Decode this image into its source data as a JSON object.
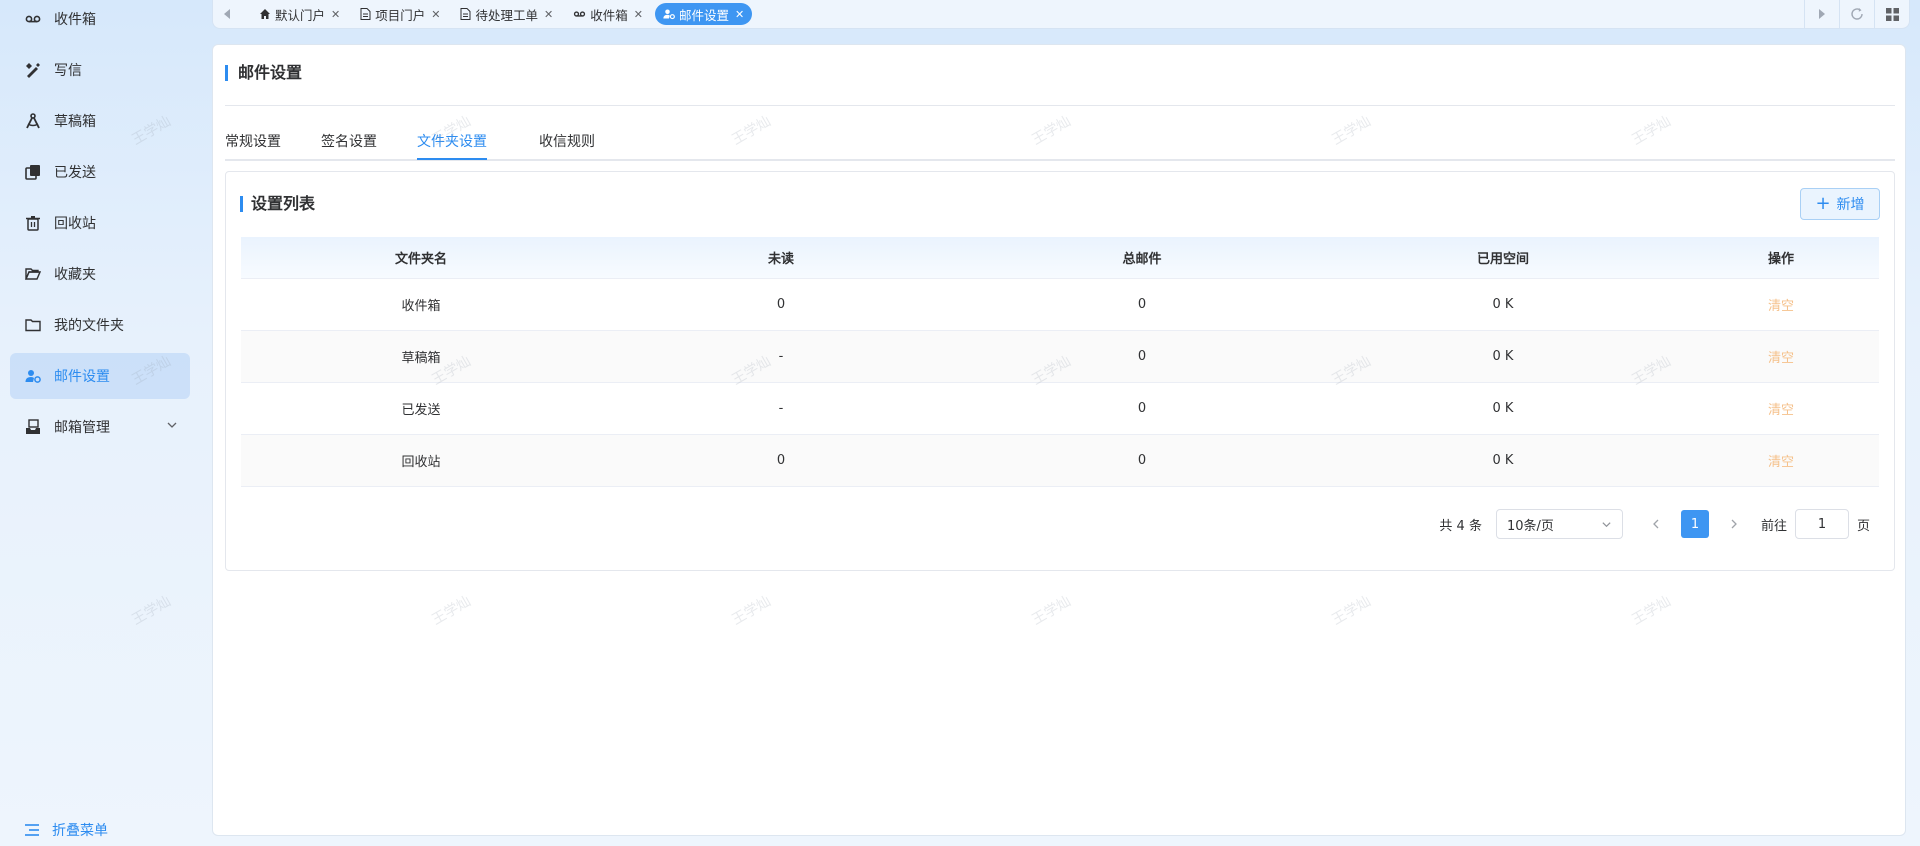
{
  "sidebar": {
    "items": [
      {
        "label": "收件箱",
        "icon": "voicemail-icon"
      },
      {
        "label": "写信",
        "icon": "pen-ruler-icon"
      },
      {
        "label": "草稿箱",
        "icon": "drafting-compass-icon"
      },
      {
        "label": "已发送",
        "icon": "copy-stack-icon"
      },
      {
        "label": "回收站",
        "icon": "trash-icon"
      },
      {
        "label": "收藏夹",
        "icon": "folder-open-icon"
      },
      {
        "label": "我的文件夹",
        "icon": "folder-icon"
      },
      {
        "label": "邮件设置",
        "icon": "user-gear-icon"
      },
      {
        "label": "邮箱管理",
        "icon": "inbox-tray-icon"
      }
    ],
    "collapse_label": "折叠菜单"
  },
  "tabbar": {
    "tabs": [
      {
        "label": "默认门户",
        "icon": "home-icon"
      },
      {
        "label": "项目门户",
        "icon": "document-icon"
      },
      {
        "label": "待处理工单",
        "icon": "document-icon"
      },
      {
        "label": "收件箱",
        "icon": "voicemail-icon"
      },
      {
        "label": "邮件设置",
        "icon": "user-gear-icon"
      }
    ]
  },
  "page": {
    "title": "邮件设置",
    "tabs": [
      "常规设置",
      "签名设置",
      "文件夹设置",
      "收信规则"
    ],
    "active_tab": "文件夹设置"
  },
  "card": {
    "title": "设置列表",
    "add_label": "新增"
  },
  "table": {
    "headers": [
      "文件夹名",
      "未读",
      "总邮件",
      "已用空间",
      "操作"
    ],
    "rows": [
      {
        "name": "收件箱",
        "unread": "0",
        "total": "0",
        "used": "0 K",
        "action": "清空"
      },
      {
        "name": "草稿箱",
        "unread": "-",
        "total": "0",
        "used": "0 K",
        "action": "清空"
      },
      {
        "name": "已发送",
        "unread": "-",
        "total": "0",
        "used": "0 K",
        "action": "清空"
      },
      {
        "name": "回收站",
        "unread": "0",
        "total": "0",
        "used": "0 K",
        "action": "清空"
      }
    ]
  },
  "pagination": {
    "total_text": "共 4 条",
    "page_size": "10条/页",
    "current_page": "1",
    "goto_label": "前往",
    "goto_value": "1",
    "page_suffix": "页"
  },
  "watermark": "王学灿",
  "colors": {
    "accent": "#2d8cf0",
    "action_link": "#f5c18b"
  }
}
